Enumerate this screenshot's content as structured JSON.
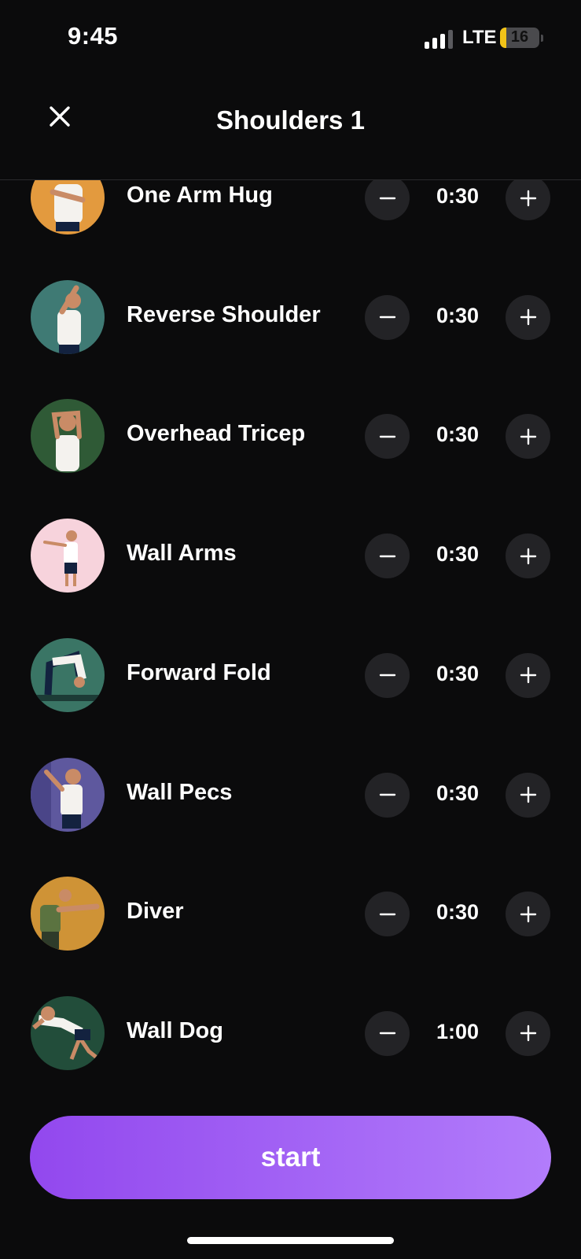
{
  "status_bar": {
    "time": "9:45",
    "network": "LTE",
    "battery": "16",
    "battery_level": 0.16
  },
  "header": {
    "title": "Shoulders 1"
  },
  "colors": {
    "accent_start": "#9248ee",
    "accent_end": "#b27cfb",
    "button_bg": "#232326",
    "background": "#0b0b0c"
  },
  "exercises": [
    {
      "name": "One Arm Hug",
      "duration": "0:30",
      "thumb_bg": "#e39a3e"
    },
    {
      "name": "Reverse Shoulder",
      "duration": "0:30",
      "thumb_bg": "#3f7a74"
    },
    {
      "name": "Overhead Tricep",
      "duration": "0:30",
      "thumb_bg": "#2f5a36"
    },
    {
      "name": "Wall Arms",
      "duration": "0:30",
      "thumb_bg": "#f7d3dc"
    },
    {
      "name": "Forward Fold",
      "duration": "0:30",
      "thumb_bg": "#3a7565"
    },
    {
      "name": "Wall Pecs",
      "duration": "0:30",
      "thumb_bg": "#5e589e"
    },
    {
      "name": "Diver",
      "duration": "0:30",
      "thumb_bg": "#cf9336"
    },
    {
      "name": "Wall Dog",
      "duration": "1:00",
      "thumb_bg": "#224d3a"
    }
  ],
  "footer": {
    "start_label": "start"
  }
}
